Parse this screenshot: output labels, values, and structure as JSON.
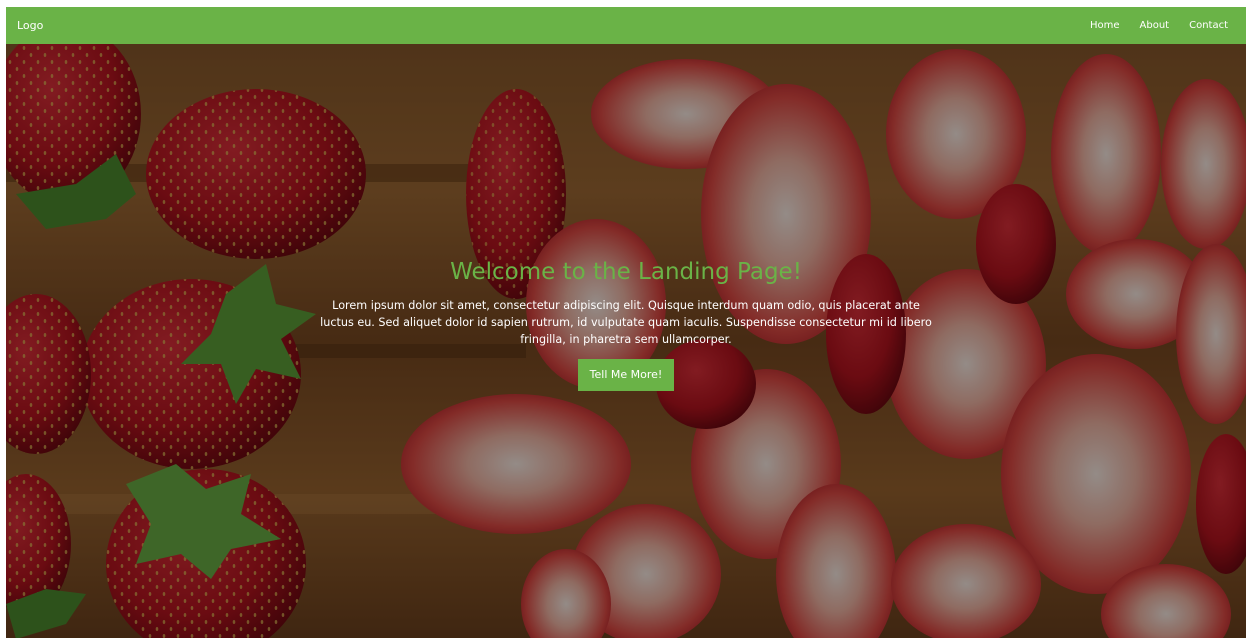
{
  "navbar": {
    "logo": "Logo",
    "links": [
      {
        "label": "Home"
      },
      {
        "label": "About"
      },
      {
        "label": "Contact"
      }
    ]
  },
  "hero": {
    "title": "Welcome to the Landing Page!",
    "body": "Lorem ipsum dolor sit amet, consectetur adipiscing elit. Quisque interdum quam odio, quis placerat ante luctus eu. Sed aliquet dolor id sapien rutrum, id vulputate quam iaculis. Suspendisse consectetur mi id libero fringilla, in pharetra sem ullamcorper.",
    "button_label": "Tell Me More!"
  },
  "colors": {
    "accent": "#6ab347",
    "nav_text": "#ffffff"
  },
  "icons": {
    "background": "strawberries-background-image"
  }
}
